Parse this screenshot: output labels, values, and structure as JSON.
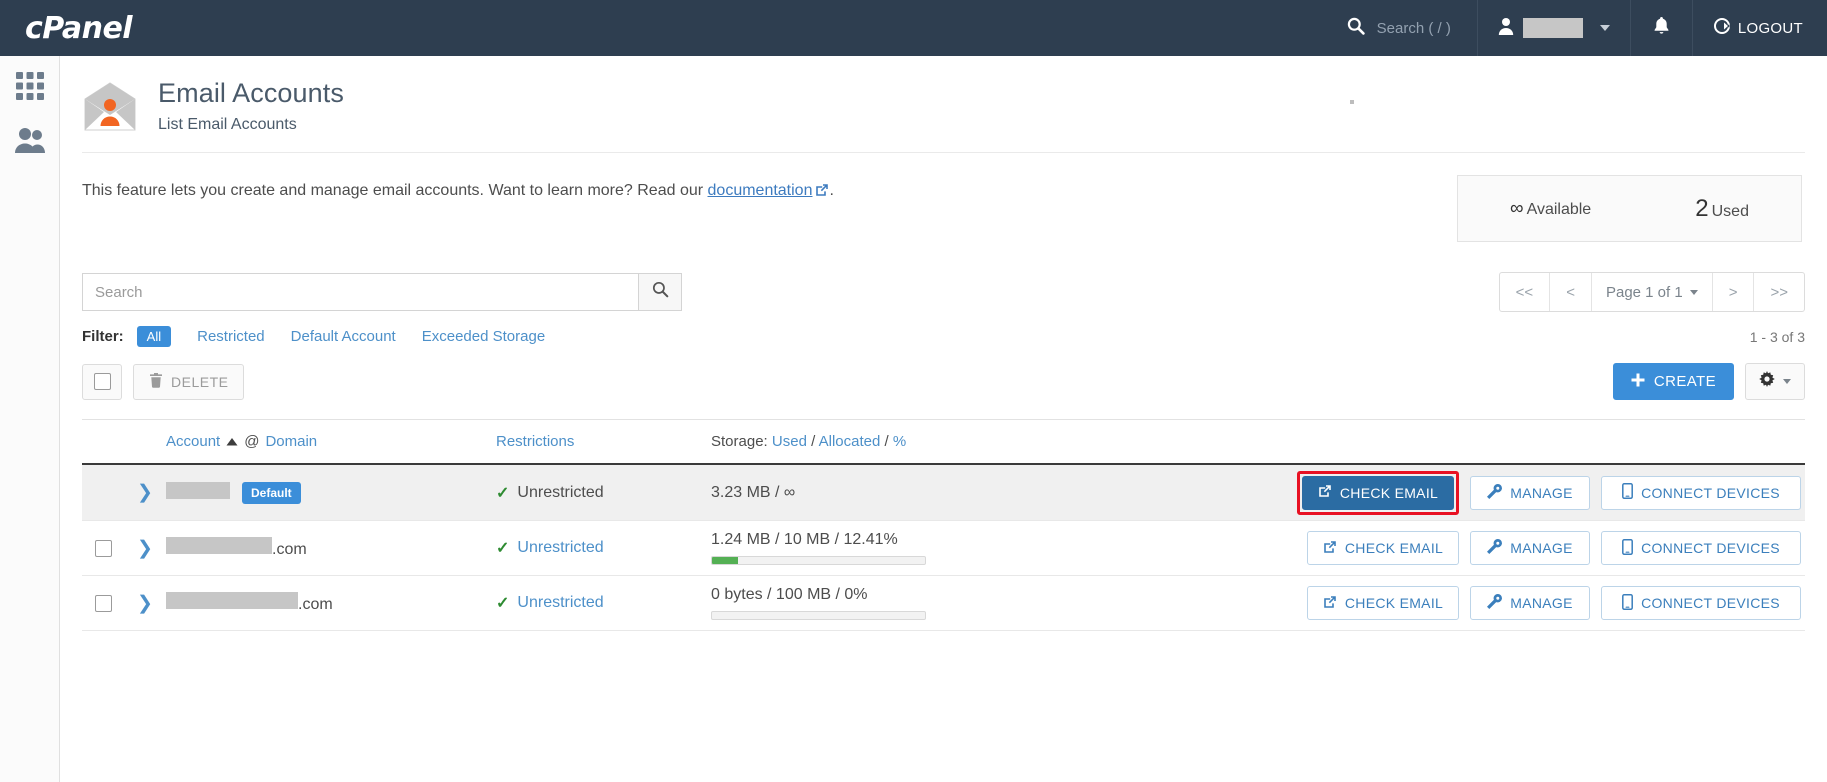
{
  "topbar": {
    "logo": "cPanel",
    "search_placeholder": "Search ( / )",
    "logout_label": "LOGOUT"
  },
  "page": {
    "title": "Email Accounts",
    "subtitle": "List Email Accounts",
    "description_before": "This feature lets you create and manage email accounts. Want to learn more? Read our ",
    "documentation_link": "documentation",
    "description_after": "."
  },
  "quota": {
    "available_value": "∞",
    "available_label": "Available",
    "used_value": "2",
    "used_label": "Used"
  },
  "search": {
    "placeholder": "Search",
    "value": ""
  },
  "pager": {
    "first": "<<",
    "prev": "<",
    "label": "Page 1 of 1",
    "next": ">",
    "last": ">>"
  },
  "filter": {
    "label": "Filter:",
    "options": [
      "All",
      "Restricted",
      "Default Account",
      "Exceeded Storage"
    ],
    "active": "All",
    "count_text": "1 - 3 of 3"
  },
  "toolbar": {
    "delete_label": "DELETE",
    "create_label": "CREATE"
  },
  "table": {
    "headers": {
      "account": "Account",
      "at": "@",
      "domain": "Domain",
      "restrictions": "Restrictions",
      "storage_label": "Storage:",
      "storage_used": "Used",
      "storage_sep1": "/",
      "storage_allocated": "Allocated",
      "storage_sep2": "/",
      "storage_percent": "%"
    },
    "actions": {
      "check_email": "CHECK EMAIL",
      "manage": "MANAGE",
      "connect_devices": "CONNECT DEVICES"
    },
    "rows": [
      {
        "is_default": true,
        "badge": "Default",
        "account_redacted_width": 64,
        "account_suffix": "",
        "restriction": "Unrestricted",
        "restriction_is_link": false,
        "storage": "3.23 MB / ∞",
        "show_bar": false,
        "bar_percent": 0,
        "highlighted_action": "check_email"
      },
      {
        "is_default": false,
        "badge": "",
        "account_redacted_width": 106,
        "account_suffix": ".com",
        "restriction": "Unrestricted",
        "restriction_is_link": true,
        "storage": "1.24 MB / 10 MB / 12.41%",
        "show_bar": true,
        "bar_percent": 12.41,
        "highlighted_action": ""
      },
      {
        "is_default": false,
        "badge": "",
        "account_redacted_width": 132,
        "account_suffix": ".com",
        "restriction": "Unrestricted",
        "restriction_is_link": true,
        "storage": "0 bytes / 100 MB / 0%",
        "show_bar": true,
        "bar_percent": 0,
        "highlighted_action": ""
      }
    ]
  },
  "colors": {
    "brand_dark": "#2e3e50",
    "accent_blue": "#3b8ed9",
    "link_blue": "#4d90c9",
    "success_green": "#2e8b32",
    "bar_green": "#54b054",
    "highlight_red": "#e81123",
    "envelope_orange": "#f26522"
  }
}
